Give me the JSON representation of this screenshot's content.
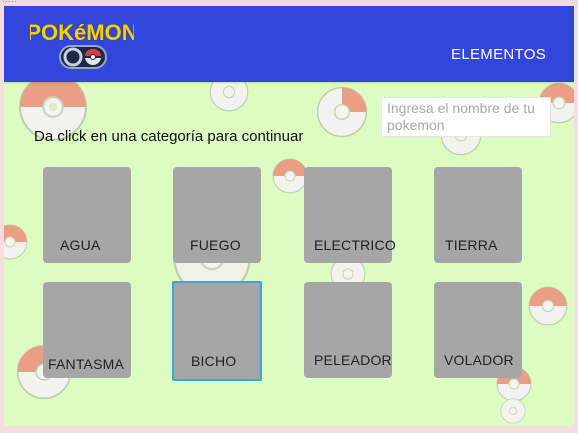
{
  "header": {
    "logo": {
      "wordmark": "POKéMON",
      "sub": "GO"
    },
    "nav_link": "ELEMENTOS"
  },
  "search": {
    "placeholder": "Ingresa el nombre de tu pokemon",
    "value": ""
  },
  "instruction": "Da click en una categoría para continuar",
  "categories": [
    {
      "label": "AGUA"
    },
    {
      "label": "FUEGO"
    },
    {
      "label": "ELECTRICO"
    },
    {
      "label": "TIERRA"
    },
    {
      "label": "FANTASMA"
    },
    {
      "label": "BICHO",
      "selected": true
    },
    {
      "label": "PELEADOR"
    },
    {
      "label": "VOLADOR"
    }
  ],
  "colors": {
    "appbar": "#3346db",
    "background": "#dcfcc2",
    "card": "#a6a6a6",
    "selection": "#33a6e6",
    "pokeball_top": "#e99e85"
  }
}
